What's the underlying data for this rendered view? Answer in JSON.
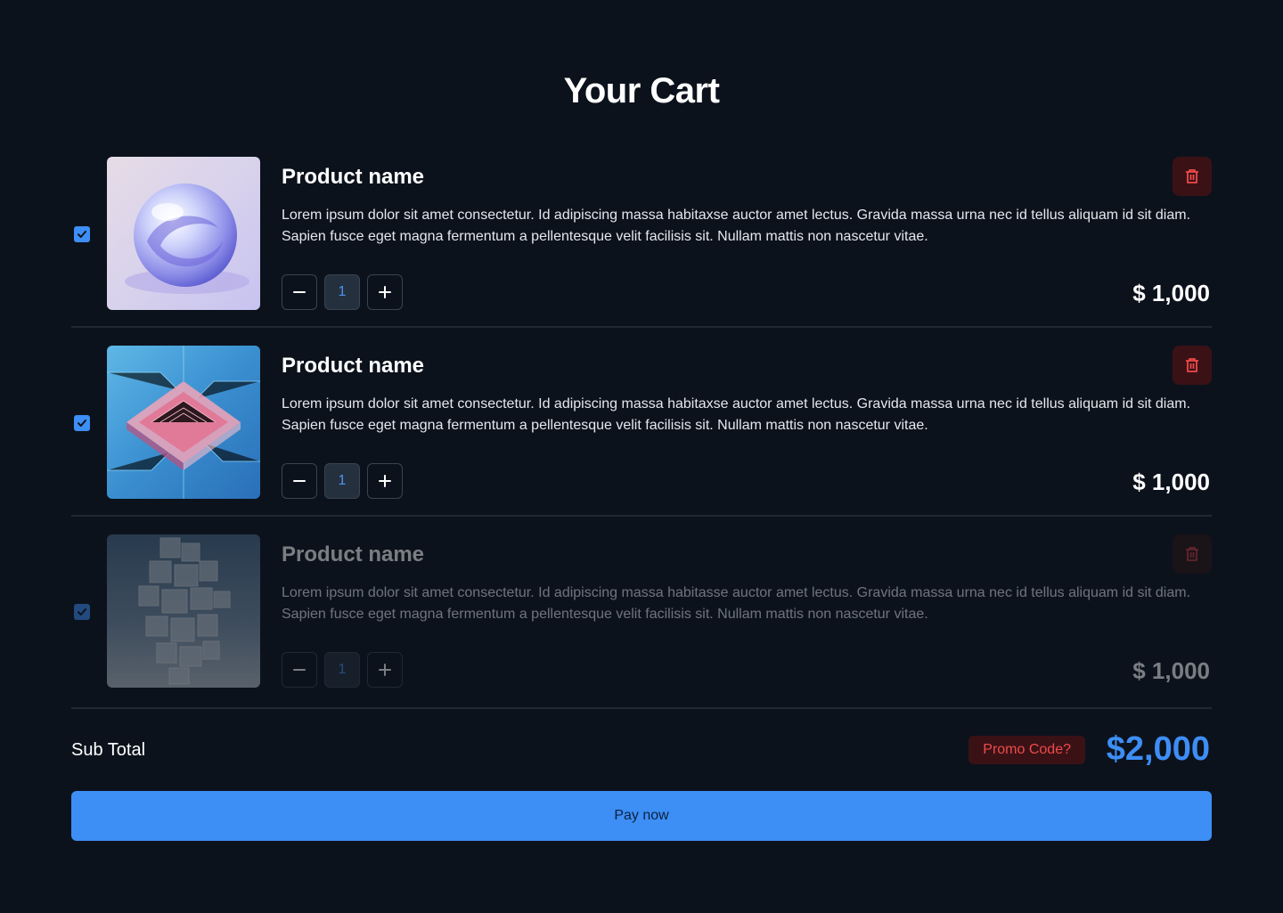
{
  "page": {
    "title": "Your Cart"
  },
  "items": [
    {
      "checked": true,
      "image": "glass-sphere-image",
      "name": "Product name",
      "description": "Lorem ipsum dolor sit amet consectetur. Id adipiscing massa habitaxse auctor amet lectus. Gravida massa urna nec id tellus aliquam id sit diam. Sapien fusce eget magna fermentum a pellentesque velit facilisis sit. Nullam mattis non nascetur vitae.",
      "quantity": "1",
      "price": "$ 1,000",
      "disabled": false
    },
    {
      "checked": true,
      "image": "circuit-chip-image",
      "name": "Product name",
      "description": "Lorem ipsum dolor sit amet consectetur. Id adipiscing massa habitaxse auctor amet lectus. Gravida massa urna nec id tellus aliquam id sit diam. Sapien fusce eget magna fermentum a pellentesque velit facilisis sit. Nullam mattis non nascetur vitae.",
      "quantity": "1",
      "price": "$ 1,000",
      "disabled": false
    },
    {
      "checked": true,
      "image": "glass-cubes-image",
      "name": "Product name",
      "description": "Lorem ipsum dolor sit amet consectetur. Id adipiscing massa habitasse auctor amet lectus. Gravida massa urna nec id tellus aliquam id sit diam. Sapien fusce eget magna fermentum a pellentesque velit facilisis sit. Nullam mattis non nascetur vitae.",
      "quantity": "1",
      "price": "$ 1,000",
      "disabled": true
    }
  ],
  "summary": {
    "subtotal_label": "Sub Total",
    "promo_label": "Promo Code?",
    "total": "$2,000"
  },
  "pay_button": {
    "label": "Pay now"
  },
  "colors": {
    "background": "#0c121c",
    "accent": "#3d8ef5",
    "danger": "#ef4a4a",
    "danger_bg": "#3a1216"
  },
  "icons": [
    "check-icon",
    "minus-icon",
    "plus-icon",
    "trash-icon"
  ]
}
